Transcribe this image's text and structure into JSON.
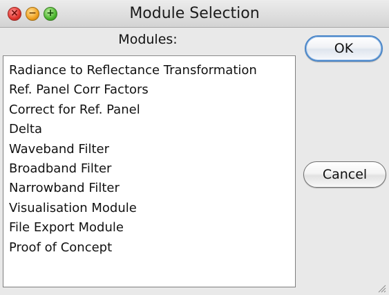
{
  "window": {
    "title": "Module Selection"
  },
  "title_bar": {
    "buttons": [
      {
        "name": "close-button",
        "icon": "close-icon",
        "glyph": "×",
        "color": "#e0342d"
      },
      {
        "name": "minimize-button",
        "icon": "minimize-icon",
        "glyph": "−",
        "color": "#f0a020"
      },
      {
        "name": "zoom-button",
        "icon": "plus-icon",
        "glyph": "+",
        "color": "#4bb52f"
      }
    ]
  },
  "modules": {
    "label": "Modules:",
    "items": [
      "Radiance to Reflectance Transformation",
      "Ref. Panel Corr Factors",
      "Correct for Ref. Panel",
      "Delta",
      "Waveband Filter",
      "Broadband Filter",
      "Narrowband Filter",
      "Visualisation Module",
      "File Export Module",
      "Proof of Concept"
    ]
  },
  "buttons": {
    "ok_label": "OK",
    "cancel_label": "Cancel"
  },
  "colors": {
    "default_button_border": "#4a86c8",
    "window_background": "#e9e9e9"
  }
}
